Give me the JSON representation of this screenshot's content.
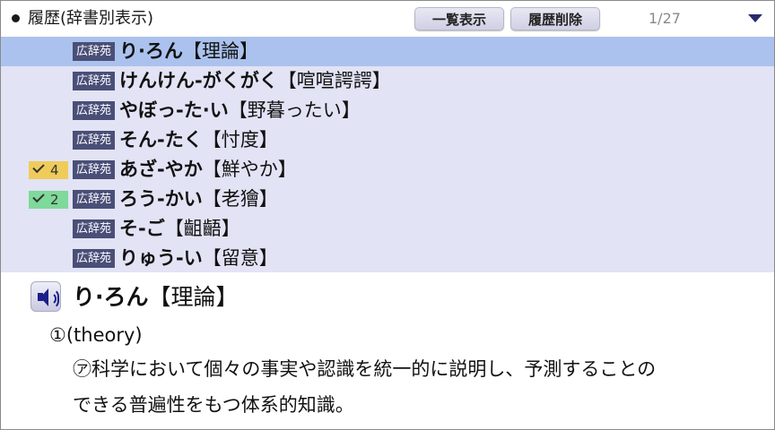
{
  "header": {
    "title": "履歴(辞書別表示)",
    "list_button": "一覧表示",
    "delete_button": "履歴削除",
    "count": "1/27"
  },
  "history": {
    "items": [
      {
        "source": "広辞苑",
        "reading": "り·ろん",
        "kanji": "【理論】",
        "selected": true,
        "mark": null
      },
      {
        "source": "広辞苑",
        "reading": "けんけん-がくがく",
        "kanji": "【喧喧諤諤】",
        "selected": false,
        "mark": null
      },
      {
        "source": "広辞苑",
        "reading": "やぼっ-た·い",
        "kanji": "【野暮ったい】",
        "selected": false,
        "mark": null
      },
      {
        "source": "広辞苑",
        "reading": "そん-たく",
        "kanji": "【忖度】",
        "selected": false,
        "mark": null
      },
      {
        "source": "広辞苑",
        "reading": "あざ-やか",
        "kanji": "【鮮やか】",
        "selected": false,
        "mark": {
          "count": "4",
          "color": "#efcc5a"
        }
      },
      {
        "source": "広辞苑",
        "reading": "ろう-かい",
        "kanji": "【老獪】",
        "selected": false,
        "mark": {
          "count": "2",
          "color": "#7fd99a"
        }
      },
      {
        "source": "広辞苑",
        "reading": "そ-ご",
        "kanji": "【齟齬】",
        "selected": false,
        "mark": null
      },
      {
        "source": "広辞苑",
        "reading": "りゅう-い",
        "kanji": "【留意】",
        "selected": false,
        "mark": null
      }
    ]
  },
  "detail": {
    "speaker_icon": "speaker-icon",
    "headword_reading": "り·ろん",
    "headword_kanji": "【理論】",
    "sense": "①(theory)",
    "definition_line1": "㋐科学において個々の事実や認識を統一的に説明し、予測することの",
    "definition_line2": "できる普遍性をもつ体系的知識。"
  },
  "colors": {
    "list_background": "#e2e3f5",
    "selected_row": "#abc2ee",
    "source_badge": "#4a4f78",
    "mark_yellow": "#efcc5a",
    "mark_green": "#7fd99a"
  }
}
